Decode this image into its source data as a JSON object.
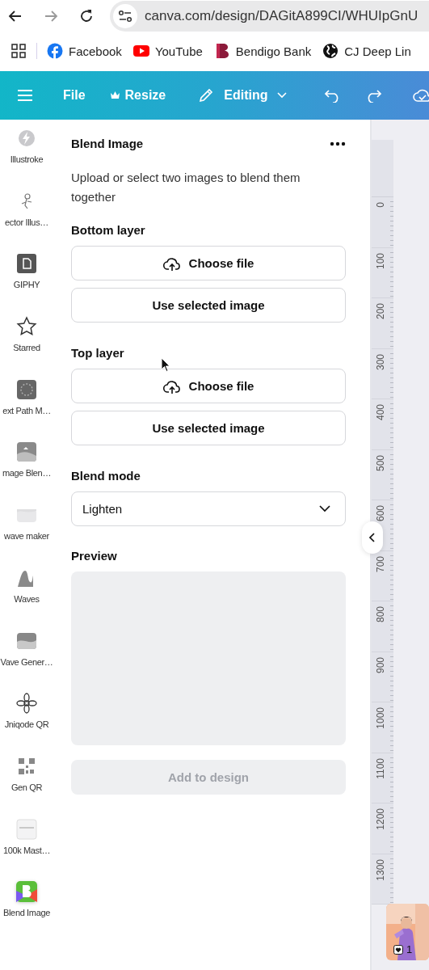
{
  "browser": {
    "back": {
      "disabled": false
    },
    "forward": {
      "disabled": true
    },
    "url": "canva.com/design/DAGitA899CI/WHUIpGnU",
    "bookmarks": [
      {
        "kind": "fb",
        "label": "Facebook"
      },
      {
        "kind": "yt",
        "label": "YouTube"
      },
      {
        "kind": "bank",
        "label": "Bendigo Bank"
      },
      {
        "kind": "globe",
        "label": "CJ Deep Lin"
      }
    ]
  },
  "toolbar": {
    "file": "File",
    "resize": "Resize",
    "editing": "Editing"
  },
  "rail": {
    "items": [
      {
        "kind": "bolt",
        "label": "Illustroke"
      },
      {
        "kind": "figure",
        "label": "ector Illus…"
      },
      {
        "kind": "doc",
        "label": "GIPHY"
      },
      {
        "kind": "star",
        "label": "Starred"
      },
      {
        "kind": "ring",
        "label": "ext Path M…"
      },
      {
        "label": "mage Blen…"
      },
      {
        "kind": "cloud",
        "label": "wave maker"
      },
      {
        "kind": "peak",
        "label": "Waves"
      },
      {
        "kind": "wave",
        "label": "Vave Gener…"
      },
      {
        "kind": "flower",
        "label": "Jniqode QR"
      },
      {
        "kind": "qr",
        "label": "Gen QR"
      },
      {
        "kind": "note",
        "label": "100k Mast…"
      },
      {
        "kind": "blend",
        "label": "Blend Image"
      }
    ]
  },
  "panel": {
    "title": "Blend Image",
    "description": "Upload or select two images to blend them together",
    "layers": [
      {
        "label": "Bottom layer",
        "choose": "Choose file",
        "use": "Use selected image"
      },
      {
        "label": "Top layer",
        "choose": "Choose file",
        "use": "Use selected image"
      }
    ],
    "blend_mode": {
      "label": "Blend mode",
      "value": "Lighten"
    },
    "preview": {
      "label": "Preview"
    },
    "add_button": {
      "label": "Add to design",
      "disabled": true
    }
  },
  "ruler": {
    "labels": [
      "0",
      "100",
      "200",
      "300",
      "400",
      "500",
      "600",
      "700",
      "800",
      "900",
      "1000",
      "1100",
      "1200",
      "1300"
    ]
  },
  "thumbnail": {
    "count": "1"
  }
}
